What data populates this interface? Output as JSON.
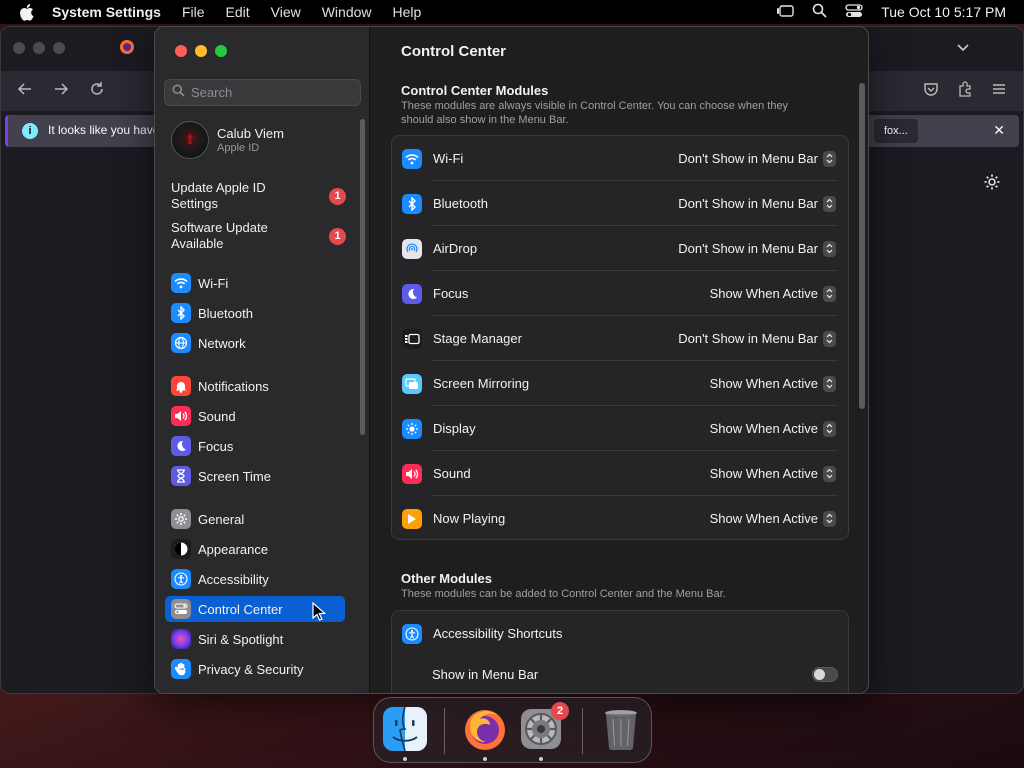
{
  "menubar": {
    "app_name": "System Settings",
    "items": [
      "File",
      "Edit",
      "View",
      "Window",
      "Help"
    ],
    "clock": "Tue Oct 10  5:17 PM"
  },
  "firefox": {
    "notification_text": "It looks like you have",
    "notification_button": "fox..."
  },
  "settings": {
    "search_placeholder": "Search",
    "user": {
      "name": "Calub Viem",
      "subtitle": "Apple ID"
    },
    "alerts": [
      {
        "label": "Update Apple ID Settings",
        "count": "1"
      },
      {
        "label": "Software Update Available",
        "count": "1"
      }
    ],
    "sidebar": {
      "items": [
        {
          "label": "Wi-Fi",
          "icon": "wifi-icon",
          "color": "#1a8cff"
        },
        {
          "label": "Bluetooth",
          "icon": "bluetooth-icon",
          "color": "#1a8cff"
        },
        {
          "label": "Network",
          "icon": "globe-icon",
          "color": "#1a8cff"
        },
        {
          "label": "Notifications",
          "icon": "bell-icon",
          "color": "#ff453a"
        },
        {
          "label": "Sound",
          "icon": "speaker-icon",
          "color": "#ff2d55"
        },
        {
          "label": "Focus",
          "icon": "moon-icon",
          "color": "#5e5ce6"
        },
        {
          "label": "Screen Time",
          "icon": "hourglass-icon",
          "color": "#5e5ce6"
        },
        {
          "label": "General",
          "icon": "gear-icon",
          "color": "#8e8e93"
        },
        {
          "label": "Appearance",
          "icon": "appearance-icon",
          "color": "#1c1c1e"
        },
        {
          "label": "Accessibility",
          "icon": "accessibility-icon",
          "color": "#1a8cff"
        },
        {
          "label": "Control Center",
          "icon": "control-center-icon",
          "color": "#8e8e93"
        },
        {
          "label": "Siri & Spotlight",
          "icon": "siri-icon",
          "color": "#b04fd6"
        },
        {
          "label": "Privacy & Security",
          "icon": "hand-icon",
          "color": "#1a8cff"
        }
      ]
    },
    "content": {
      "title": "Control Center",
      "modules_section": {
        "title": "Control Center Modules",
        "description": "These modules are always visible in Control Center. You can choose when they should also show in the Menu Bar."
      },
      "modules": [
        {
          "label": "Wi-Fi",
          "value": "Don't Show in Menu Bar",
          "icon": "wifi-icon",
          "color": "#1a8cff"
        },
        {
          "label": "Bluetooth",
          "value": "Don't Show in Menu Bar",
          "icon": "bluetooth-icon",
          "color": "#1a8cff"
        },
        {
          "label": "AirDrop",
          "value": "Don't Show in Menu Bar",
          "icon": "airdrop-icon",
          "color": "#e6e6ea"
        },
        {
          "label": "Focus",
          "value": "Show When Active",
          "icon": "moon-icon",
          "color": "#5e5ce6"
        },
        {
          "label": "Stage Manager",
          "value": "Don't Show in Menu Bar",
          "icon": "stage-manager-icon",
          "color": "#1c1c1e"
        },
        {
          "label": "Screen Mirroring",
          "value": "Show When Active",
          "icon": "screen-mirroring-icon",
          "color": "#5ac8fa"
        },
        {
          "label": "Display",
          "value": "Show When Active",
          "icon": "sun-icon",
          "color": "#1a8cff"
        },
        {
          "label": "Sound",
          "value": "Show When Active",
          "icon": "speaker-icon",
          "color": "#ff2d55"
        },
        {
          "label": "Now Playing",
          "value": "Show When Active",
          "icon": "play-icon",
          "color": "#ff9f0a"
        }
      ],
      "other_section": {
        "title": "Other Modules",
        "description": "These modules can be added to Control Center and the Menu Bar."
      },
      "other_modules": [
        {
          "label": "Accessibility Shortcuts",
          "icon": "accessibility-icon",
          "color": "#1a8cff"
        }
      ],
      "show_in_menu_bar_label": "Show in Menu Bar",
      "show_in_menu_bar_value": false
    }
  },
  "dock": {
    "apps": [
      "finder-icon",
      "firefox-icon",
      "system-settings-icon",
      "trash-icon"
    ],
    "settings_badge": "2"
  }
}
